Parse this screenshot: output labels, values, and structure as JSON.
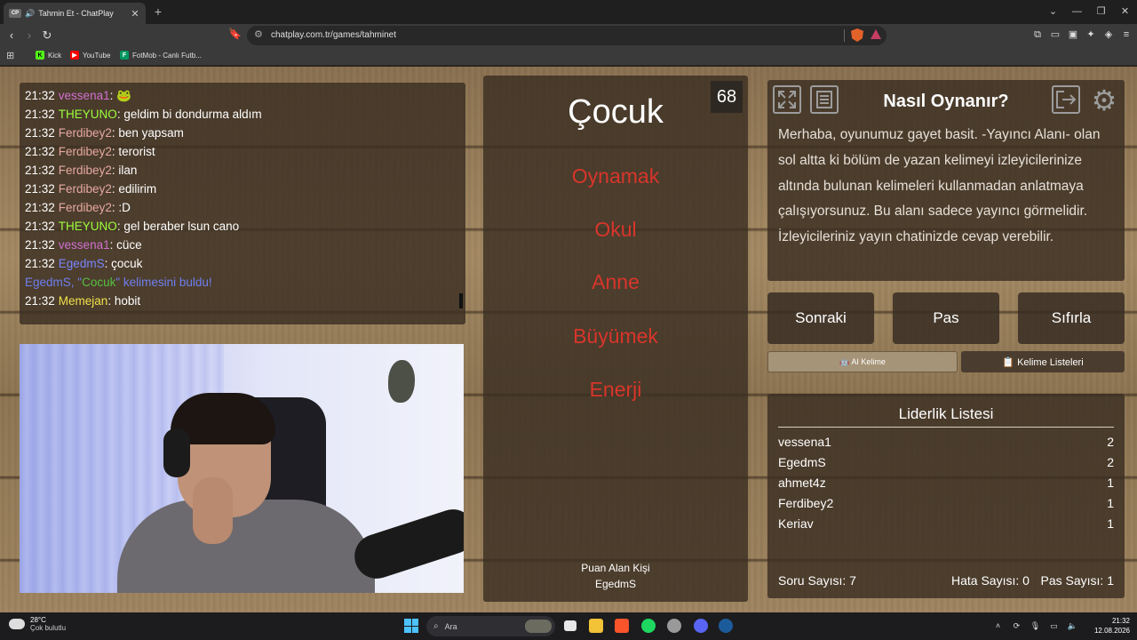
{
  "browser": {
    "tab_title": "Tahmin Et - ChatPlay",
    "tab_favicon": "CP",
    "url": "chatplay.com.tr/games/tahminet",
    "bookmarks": [
      {
        "label": "Kick",
        "icon": "kick-icon",
        "color": "#53fc18"
      },
      {
        "label": "YouTube",
        "icon": "youtube-icon",
        "color": "#ff0000"
      },
      {
        "label": "FotMob - Canlı Futb...",
        "icon": "fotmob-icon",
        "color": "#00985f"
      }
    ]
  },
  "chat": {
    "messages": [
      {
        "time": "21:32",
        "user": "vessena1",
        "color": "#d070d0",
        "text": ": 🐸"
      },
      {
        "time": "21:32",
        "user": "THEYUNO",
        "color": "#9cff3a",
        "text": ": geldim bi dondurma aldım"
      },
      {
        "time": "21:32",
        "user": "Ferdibey2",
        "color": "#e6a8a0",
        "text": ": ben yapsam"
      },
      {
        "time": "21:32",
        "user": "Ferdibey2",
        "color": "#e6a8a0",
        "text": ": terorist"
      },
      {
        "time": "21:32",
        "user": "Ferdibey2",
        "color": "#e6a8a0",
        "text": ": ilan"
      },
      {
        "time": "21:32",
        "user": "Ferdibey2",
        "color": "#e6a8a0",
        "text": ": edilirim"
      },
      {
        "time": "21:32",
        "user": "Ferdibey2",
        "color": "#e6a8a0",
        "text": ": :D"
      },
      {
        "time": "21:32",
        "user": "THEYUNO",
        "color": "#9cff3a",
        "text": ": gel beraber lsun cano"
      },
      {
        "time": "21:32",
        "user": "vessena1",
        "color": "#d070d0",
        "text": ": cüce"
      },
      {
        "time": "21:32",
        "user": "EgedmS",
        "color": "#7a86ff",
        "text": ": çocuk"
      }
    ],
    "system_message": {
      "prefix": "EgedmS, \"",
      "word": "Cocuk",
      "suffix": "\" kelimesini buldu!"
    },
    "last_message": {
      "time": "21:32",
      "user": "Memejan",
      "color": "#f2e14a",
      "text": ": hobit"
    }
  },
  "game": {
    "counter": "68",
    "word": "Çocuk",
    "taboo_words": [
      "Oynamak",
      "Okul",
      "Anne",
      "Büyümek",
      "Enerji"
    ],
    "scorer_label": "Puan Alan Kişi",
    "scorer_name": "EgedmS"
  },
  "howto": {
    "title": "Nasıl Oynanır?",
    "text": "Merhaba, oyunumuz gayet basit. -Yayıncı Alanı- olan sol altta ki bölüm de yazan kelimeyi izleyicilerinize altında bulunan kelimeleri kullanmadan anlatmaya çalışıyorsunuz. Bu alanı sadece yayıncı görmelidir. İzleyicileriniz yayın chatinizde cevap verebilir."
  },
  "actions": {
    "next": "Sonraki",
    "pass": "Pas",
    "reset": "Sıfırla"
  },
  "tabs": {
    "ai": "🤖 AI Kelime",
    "lists": "📋 Kelime Listeleri"
  },
  "leaderboard": {
    "title": "Liderlik Listesi",
    "rows": [
      {
        "name": "vessena1",
        "score": "2"
      },
      {
        "name": "EgedmS",
        "score": "2"
      },
      {
        "name": "ahmet4z",
        "score": "1"
      },
      {
        "name": "Ferdibey2",
        "score": "1"
      },
      {
        "name": "Keriav",
        "score": "1"
      }
    ]
  },
  "stats": {
    "questions": "Soru Sayısı: 7",
    "errors": "Hata Sayısı: 0",
    "passes": "Pas Sayısı: 1"
  },
  "taskbar": {
    "temperature": "28°C",
    "weather": "Çok bulutlu",
    "search_placeholder": "Ara",
    "time": "21:32",
    "date": "12.08.2026"
  }
}
